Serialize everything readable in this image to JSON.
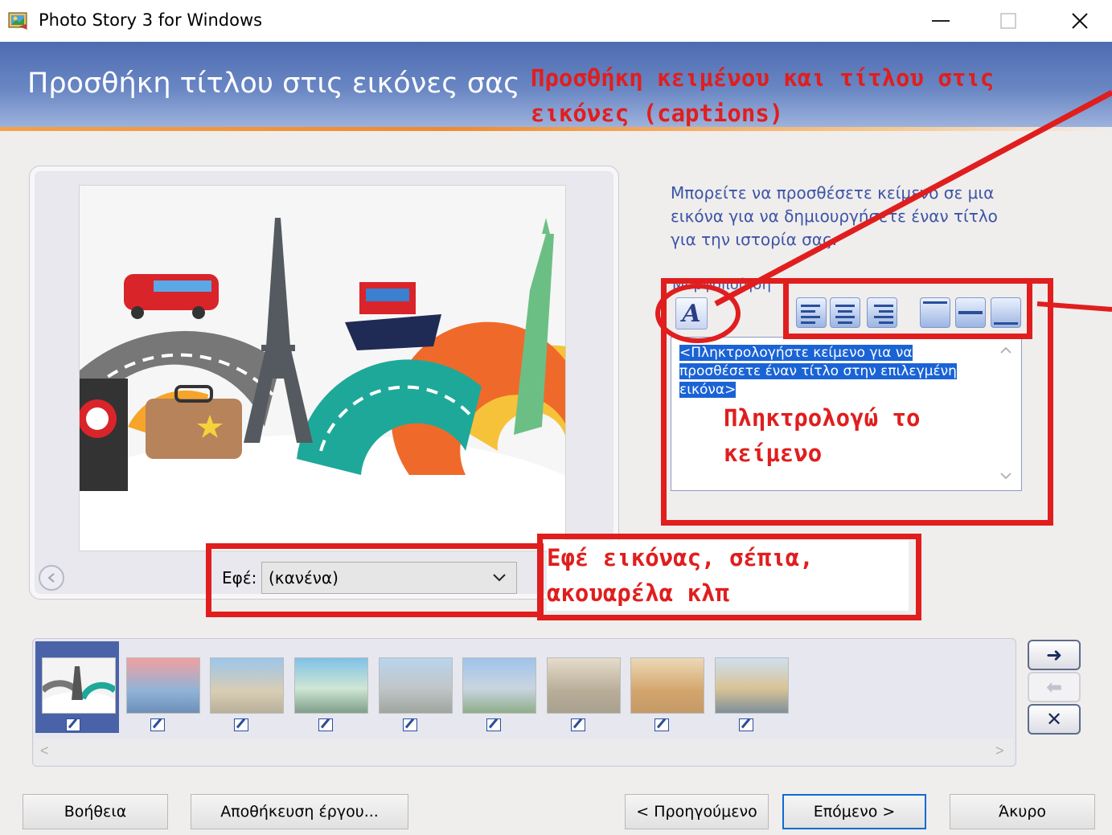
{
  "window": {
    "title": "Photo Story 3 for Windows",
    "minimize": "—",
    "maximize": "☐",
    "close": "✕"
  },
  "header": {
    "heading": "Προσθήκη τίτλου στις εικόνες σας",
    "annotation": "Προσθήκη κειμένου και τίτλου στις εικόνες (captions)"
  },
  "preview": {
    "effect_label": "Εφέ:",
    "effect_value": "(κανένα)",
    "effect_annotation": "Εφέ εικόνας, σέπια, ακουαρέλα κλπ"
  },
  "text_panel": {
    "help": "Μπορείτε να προσθέσετε κείμενο σε μια εικόνα για να δημιουργήσετε έναν τίτλο για την ιστορία σας.",
    "font_label": "Μορφοποίηση",
    "font_button": "A",
    "caption_placeholder": "<Πληκτρολογήστε κείμενο για να προσθέσετε έναν τίτλο στην επιλεγμένη εικόνα>",
    "caption_annotation": "Πληκτρολογώ το κείμενο",
    "align_buttons": [
      "align-left",
      "align-center",
      "align-right",
      "position-top",
      "position-middle",
      "position-bottom"
    ]
  },
  "filmstrip": {
    "thumbnails": [
      "travel-collage",
      "city-river-sunset",
      "arch-monument",
      "chain-bridge",
      "lighthouse-bridge",
      "eiffel-tower",
      "louvre-plaza",
      "colosseum",
      "canal-houses"
    ],
    "selected_index": 0,
    "scroll_left": "<",
    "scroll_right": ">"
  },
  "side_buttons": {
    "move_right": "➜",
    "move_left": "⬅",
    "delete": "✕"
  },
  "footer": {
    "help": "Βοήθεια",
    "save": "Αποθήκευση έργου...",
    "previous": "< Προηγούμενο",
    "next": "Επόμενο >",
    "cancel": "Άκυρο"
  }
}
